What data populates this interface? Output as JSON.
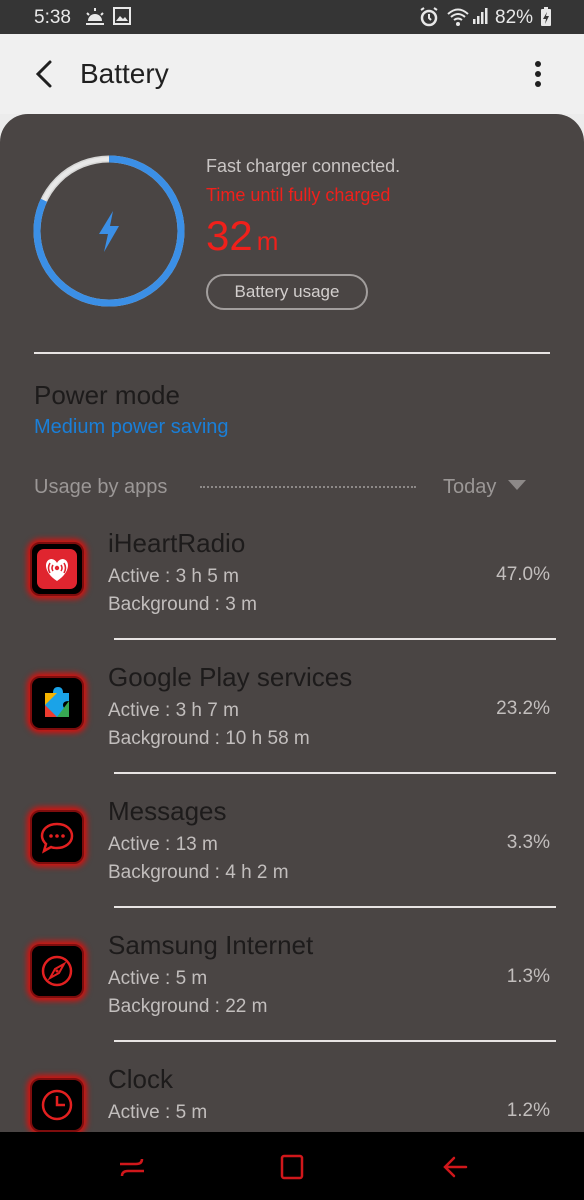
{
  "status_bar": {
    "time": "5:38",
    "battery": "82%"
  },
  "header": {
    "title": "Battery"
  },
  "charging": {
    "level": 0.82,
    "status": "Fast charger connected.",
    "time_label": "Time until fully charged",
    "time_value": "32",
    "time_unit": "m",
    "usage_button": "Battery usage"
  },
  "power_mode": {
    "title": "Power mode",
    "value": "Medium power saving"
  },
  "usage": {
    "label": "Usage by apps",
    "period": "Today"
  },
  "apps": [
    {
      "name": "iHeartRadio",
      "active": "Active : 3 h 5 m",
      "background": "Background : 3 m",
      "percent": "47.0%",
      "icon": "iheartradio-icon"
    },
    {
      "name": "Google Play services",
      "active": "Active : 3 h 7 m",
      "background": "Background : 10 h 58 m",
      "percent": "23.2%",
      "icon": "puzzle-icon"
    },
    {
      "name": "Messages",
      "active": "Active : 13 m",
      "background": "Background : 4 h 2 m",
      "percent": "3.3%",
      "icon": "chat-bubble-icon"
    },
    {
      "name": "Samsung Internet",
      "active": "Active : 5 m",
      "background": "Background : 22 m",
      "percent": "1.3%",
      "icon": "compass-icon"
    },
    {
      "name": "Clock",
      "active": "Active : 5 m",
      "background": "",
      "percent": "1.2%",
      "icon": "clock-icon"
    }
  ],
  "colors": {
    "accent_red": "#f0201b",
    "accent_blue": "#1a7fd8",
    "card_bg": "#4a4544"
  }
}
